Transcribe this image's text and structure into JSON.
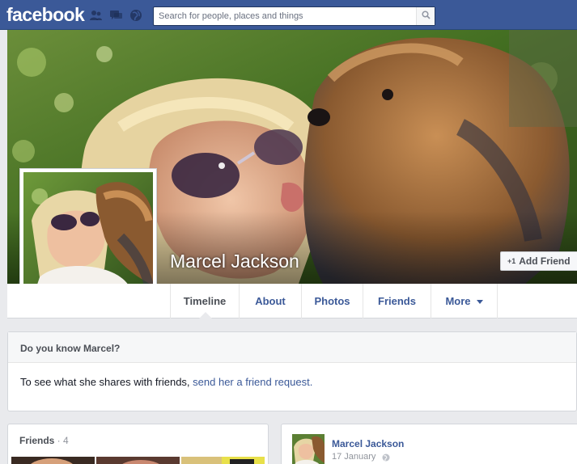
{
  "header": {
    "logo": "facebook",
    "icons": [
      "friend-requests-icon",
      "messages-icon",
      "notifications-globe-icon"
    ],
    "search_placeholder": "Search for people, places and things"
  },
  "profile": {
    "name": "Marcel Jackson",
    "add_friend_label": "Add Friend",
    "add_friend_icon": "+1"
  },
  "nav": {
    "tabs": [
      {
        "label": "Timeline",
        "active": true
      },
      {
        "label": "About"
      },
      {
        "label": "Photos"
      },
      {
        "label": "Friends"
      },
      {
        "label": "More",
        "has_dropdown": true
      }
    ]
  },
  "know_card": {
    "title": "Do you know Marcel?",
    "body_prefix": "To see what she shares with friends, ",
    "link": "send her a friend request."
  },
  "friends_card": {
    "title": "Friends",
    "separator": " · ",
    "count": "4"
  },
  "post": {
    "author": "Marcel Jackson",
    "date": "17 January"
  },
  "colors": {
    "brand": "#3b5998",
    "background": "#e9eaed",
    "link": "#3b5998"
  }
}
